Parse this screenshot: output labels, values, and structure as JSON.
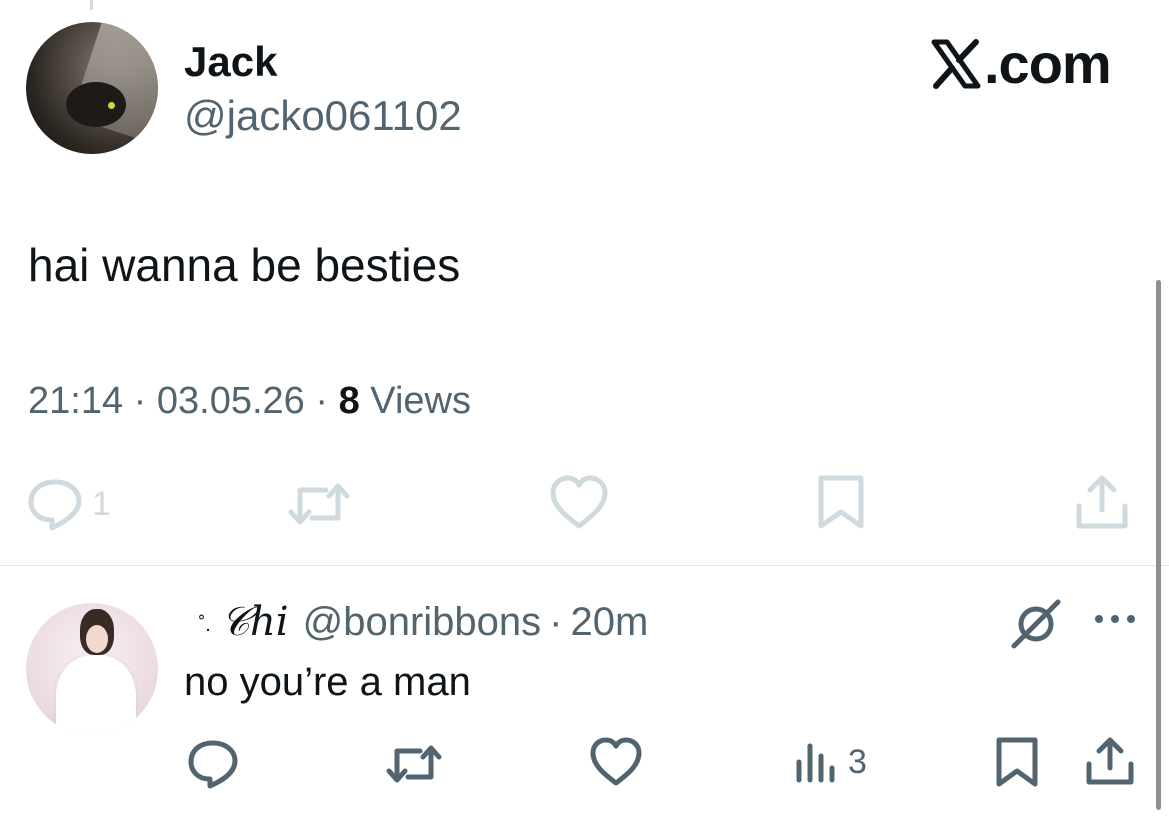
{
  "brand": {
    "text": ".com"
  },
  "tweet": {
    "author": {
      "name": "Jack",
      "handle": "@jacko061102"
    },
    "text": "hai wanna be besties",
    "meta": {
      "time": "21:14",
      "separator": "·",
      "date": "03.05.26",
      "views_count": "8",
      "views_label": "Views"
    },
    "actions": {
      "reply_count": "1"
    }
  },
  "reply": {
    "author": {
      "decoration": "⠀˚.",
      "name": "𝒞hi",
      "handle": "@bonribbons"
    },
    "separator": "·",
    "time": "20m",
    "text": "no you’re a man",
    "actions": {
      "views_count": "3"
    }
  },
  "icons": [
    "reply-icon",
    "repost-icon",
    "like-icon",
    "bookmark-icon",
    "share-icon",
    "views-icon",
    "grok-icon",
    "more-icon"
  ],
  "colors": {
    "text": "#0f1419",
    "secondary": "#536471",
    "faded": "#cfd9de",
    "divider": "#e1e8ed"
  }
}
